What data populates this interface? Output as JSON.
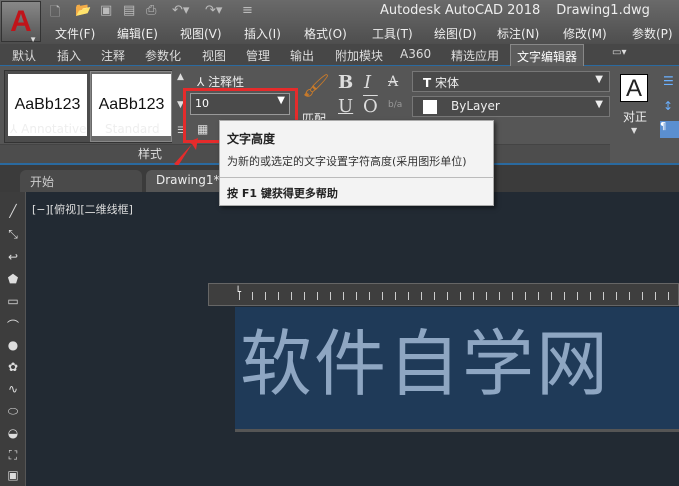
{
  "app": {
    "title": "Autodesk AutoCAD 2018",
    "file": "Drawing1.dwg",
    "logo": "A"
  },
  "menu": [
    "文件(F)",
    "编辑(E)",
    "视图(V)",
    "插入(I)",
    "格式(O)",
    "工具(T)",
    "绘图(D)",
    "标注(N)",
    "修改(M)",
    "参数(P)"
  ],
  "ribbon_tabs": [
    "默认",
    "插入",
    "注释",
    "参数化",
    "视图",
    "管理",
    "输出",
    "附加模块",
    "A360",
    "精选应用",
    "文字编辑器"
  ],
  "ribbon": {
    "styles": [
      {
        "preview": "AaBb123",
        "name": "Annotative"
      },
      {
        "preview": "AaBb123",
        "name": "Standard"
      }
    ],
    "annotative_label": "注释性",
    "text_height": "10",
    "match_label": "匹配",
    "bold": "B",
    "italic": "I",
    "strike": "A",
    "underline": "U",
    "overline": "O",
    "stack": "b/a",
    "font": "宋体",
    "color": "ByLayer",
    "justify_label": "对正",
    "panel_style_label": "样式"
  },
  "tooltip": {
    "title": "文字高度",
    "desc": "为新的或选定的文字设置字符高度(采用图形单位)",
    "help": "按 F1 键获得更多帮助"
  },
  "doc_tabs": [
    "开始",
    "Drawing1*"
  ],
  "viewport_label": "[−][俯视][二维线框]",
  "mtext": "软件自学网",
  "colors": {
    "highlight": "#e52b2b",
    "accent": "#2a6aa0"
  }
}
